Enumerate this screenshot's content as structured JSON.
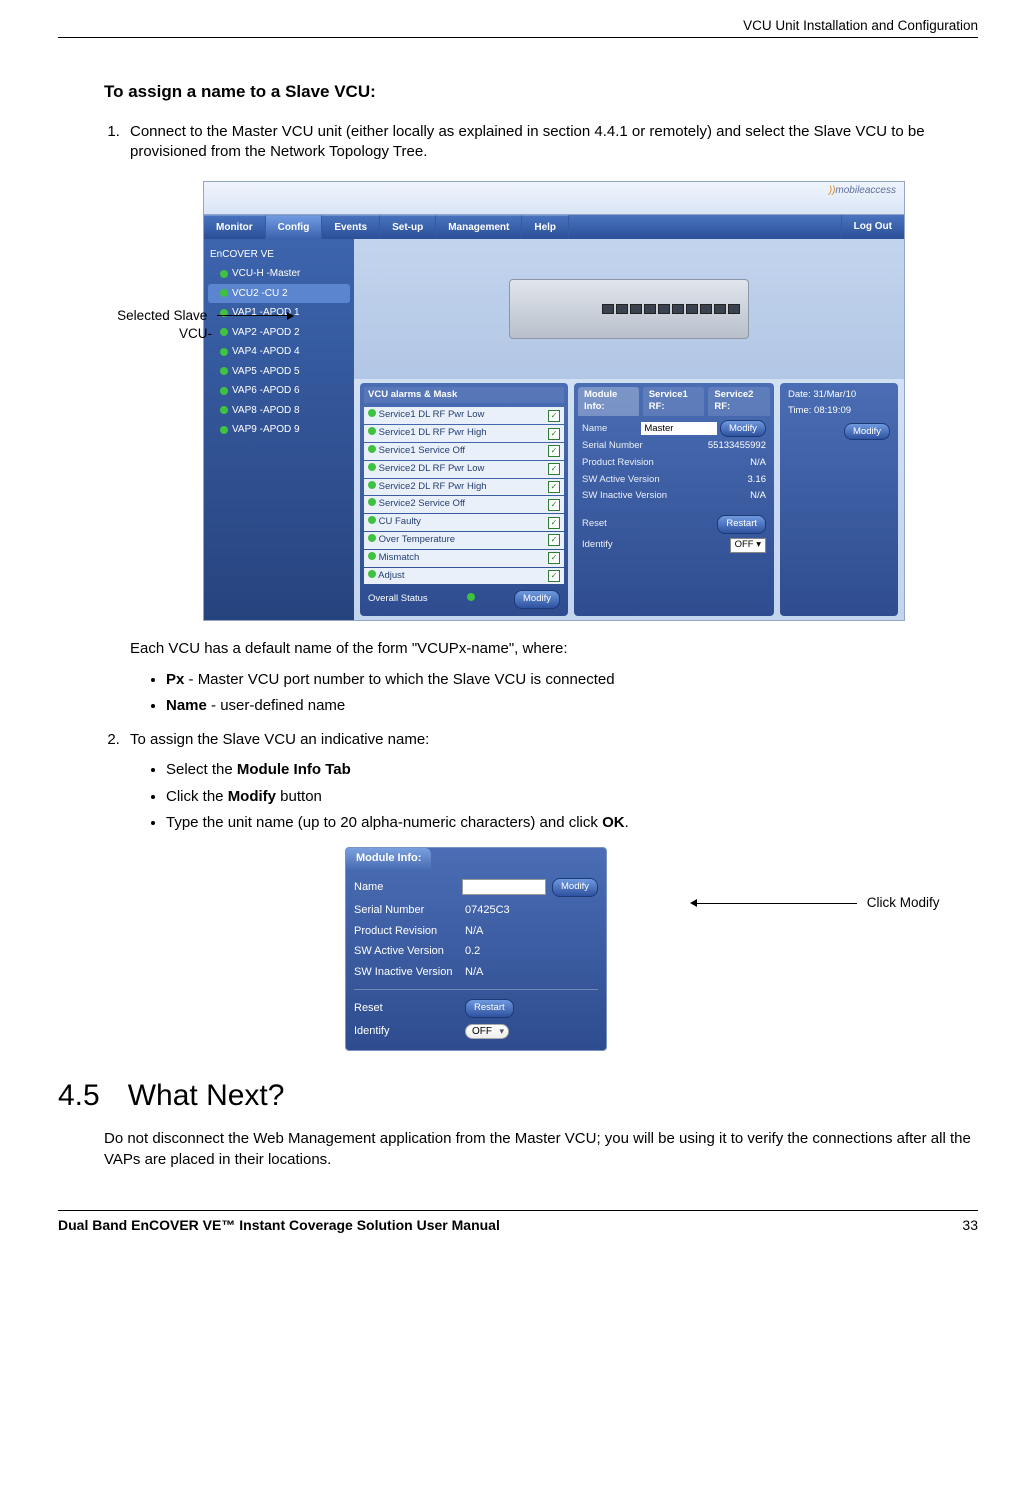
{
  "running_head": "VCU Unit Installation and Configuration",
  "task_title": "To assign a name to a Slave VCU:",
  "step1": "Connect to the Master VCU unit (either locally as explained in section 4.4.1 or remotely) and select the Slave VCU to be provisioned from the Network Topology Tree.",
  "callout_left_l1": "Selected Slave",
  "callout_left_l2": "VCU-",
  "app": {
    "logo_text": "mobileaccess",
    "tabs": [
      "Monitor",
      "Config",
      "Events",
      "Set-up",
      "Management",
      "Help"
    ],
    "logout": "Log Out",
    "tree": [
      "EnCOVER VE",
      "VCU-H -Master",
      "VCU2 -CU 2",
      "VAP1 -APOD 1",
      "VAP2 -APOD 2",
      "VAP4 -APOD 4",
      "VAP5 -APOD 5",
      "VAP6 -APOD 6",
      "VAP8 -APOD 8",
      "VAP9 -APOD 9"
    ],
    "alarms_title": "VCU alarms & Mask",
    "alarms": [
      "Service1 DL RF Pwr Low",
      "Service1 DL RF Pwr High",
      "Service1 Service Off",
      "Service2 DL RF Pwr Low",
      "Service2 DL RF Pwr High",
      "Service2 Service Off",
      "CU Faulty",
      "Over Temperature",
      "Mismatch",
      "Adjust"
    ],
    "overall_label": "Overall Status",
    "modify_btn": "Modify",
    "info_tabs": [
      "Module Info:",
      "Service1 RF:",
      "Service2 RF:"
    ],
    "info": {
      "name_lbl": "Name",
      "name_val": "Master",
      "sn_lbl": "Serial Number",
      "sn_val": "55133455992",
      "pr_lbl": "Product Revision",
      "pr_val": "N/A",
      "swa_lbl": "SW Active Version",
      "swa_val": "3.16",
      "swi_lbl": "SW Inactive Version",
      "swi_val": "N/A",
      "reset_lbl": "Reset",
      "restart_btn": "Restart",
      "ident_lbl": "Identify",
      "ident_val": "OFF"
    },
    "dt": {
      "date_lbl": "Date:",
      "date_val": "31/Mar/10",
      "time_lbl": "Time:",
      "time_val": "08:19:09",
      "modify_btn": "Modify"
    }
  },
  "after_fig1": "Each VCU has a default name of the form \"VCUPx-name\", where:",
  "px_bold": "Px",
  "px_rest": " - Master VCU port number to which the Slave VCU is connected",
  "name_bold": "Name",
  "name_rest": " - user-defined name",
  "step2_intro": "To assign the Slave VCU an indicative name:",
  "b2_1_pre": "Select the ",
  "b2_1_bold": "Module Info Tab",
  "b2_2_pre": "Click the ",
  "b2_2_bold": "Modify",
  "b2_2_post": " button",
  "b2_3_pre": "Type the unit name (up to 20 alpha-numeric characters) and click ",
  "b2_3_bold": "OK",
  "b2_3_post": ".",
  "callout_right": "Click Modify",
  "modinfo": {
    "tab": "Module Info:",
    "name_lbl": "Name",
    "sn_lbl": "Serial Number",
    "sn_val": "07425C3",
    "pr_lbl": "Product Revision",
    "pr_val": "N/A",
    "swa_lbl": "SW Active Version",
    "swa_val": "0.2",
    "swi_lbl": "SW Inactive Version",
    "swi_val": "N/A",
    "reset_lbl": "Reset",
    "restart_btn": "Restart",
    "ident_lbl": "Identify",
    "ident_val": "OFF",
    "modify_btn": "Modify"
  },
  "h2_num": "4.5",
  "h2_title": "What Next?",
  "h2_body": "Do not disconnect the Web Management application from the Master VCU; you will be using it to verify the connections after all the VAPs are placed in their locations.",
  "footer_title": "Dual Band EnCOVER VE™ Instant Coverage Solution User Manual",
  "page_num": "33"
}
